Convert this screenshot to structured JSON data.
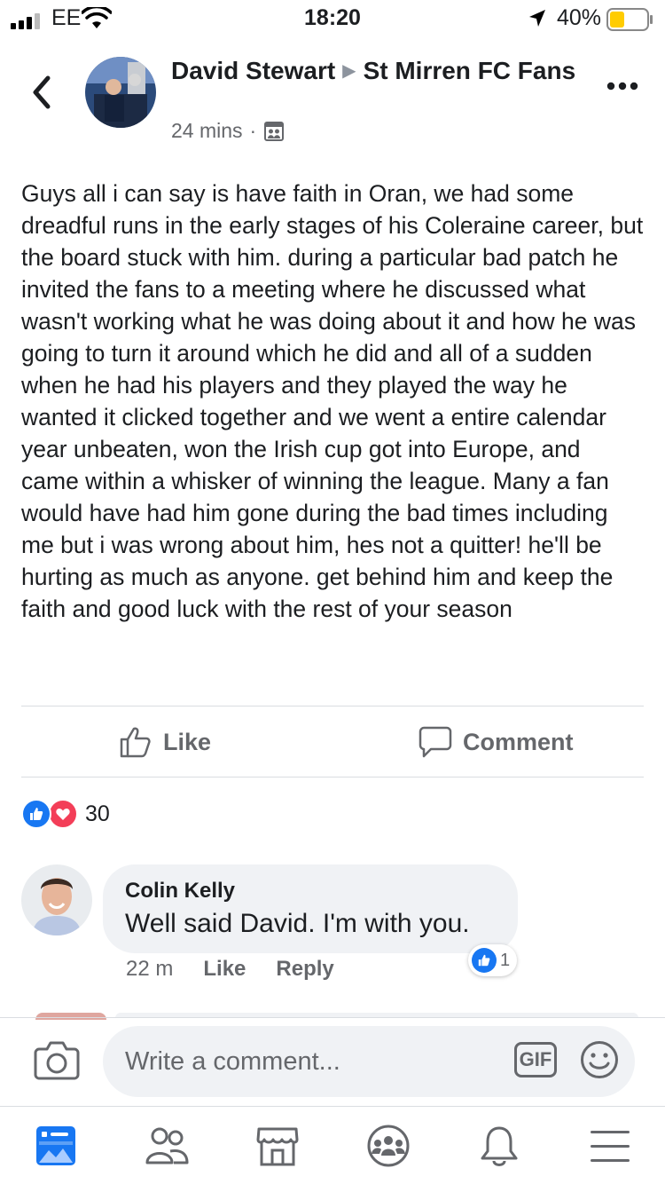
{
  "status_bar": {
    "carrier": "EE",
    "time": "18:20",
    "battery_percent": "40%",
    "battery_level": 0.4
  },
  "post": {
    "author": "David Stewart",
    "group": "St Mirren FC Fans",
    "time_ago": "24 mins",
    "audience_icon": "group-icon",
    "text": "Guys all i can say is have faith in Oran, we had some dreadful runs in  the early stages of his Coleraine career,  but the board stuck with him. during a particular bad patch he invited the fans to a meeting where he discussed what wasn't working what he was doing about it and how he was going to turn it around which he did and all of a sudden when he had his players and they played the way he wanted it clicked together and we went a entire calendar year unbeaten, won the Irish cup got into Europe, and came within a whisker of winning the league. Many a fan would have had him gone during the bad times including me but i was wrong about him, hes not a quitter! he'll be hurting as much as anyone. get behind him and keep the faith and good luck with the rest of your season",
    "like_label": "Like",
    "comment_label": "Comment",
    "reaction_count": "30",
    "reaction_icons": [
      "like-icon",
      "love-icon"
    ]
  },
  "comment": {
    "name": "Colin Kelly",
    "text": "Well said David. I'm with you.",
    "time_ago": "22 m",
    "like_label": "Like",
    "reply_label": "Reply",
    "like_count": "1"
  },
  "composer": {
    "placeholder": "Write a comment...",
    "gif_label": "GIF"
  },
  "tabbar": [
    "news-feed-tab",
    "friends-tab",
    "marketplace-tab",
    "groups-tab",
    "notifications-tab",
    "menu-tab"
  ],
  "colors": {
    "brand_blue": "#1877f2",
    "love_red": "#f33e58",
    "secondary_text": "#65676b",
    "bubble_bg": "#f0f2f5"
  }
}
